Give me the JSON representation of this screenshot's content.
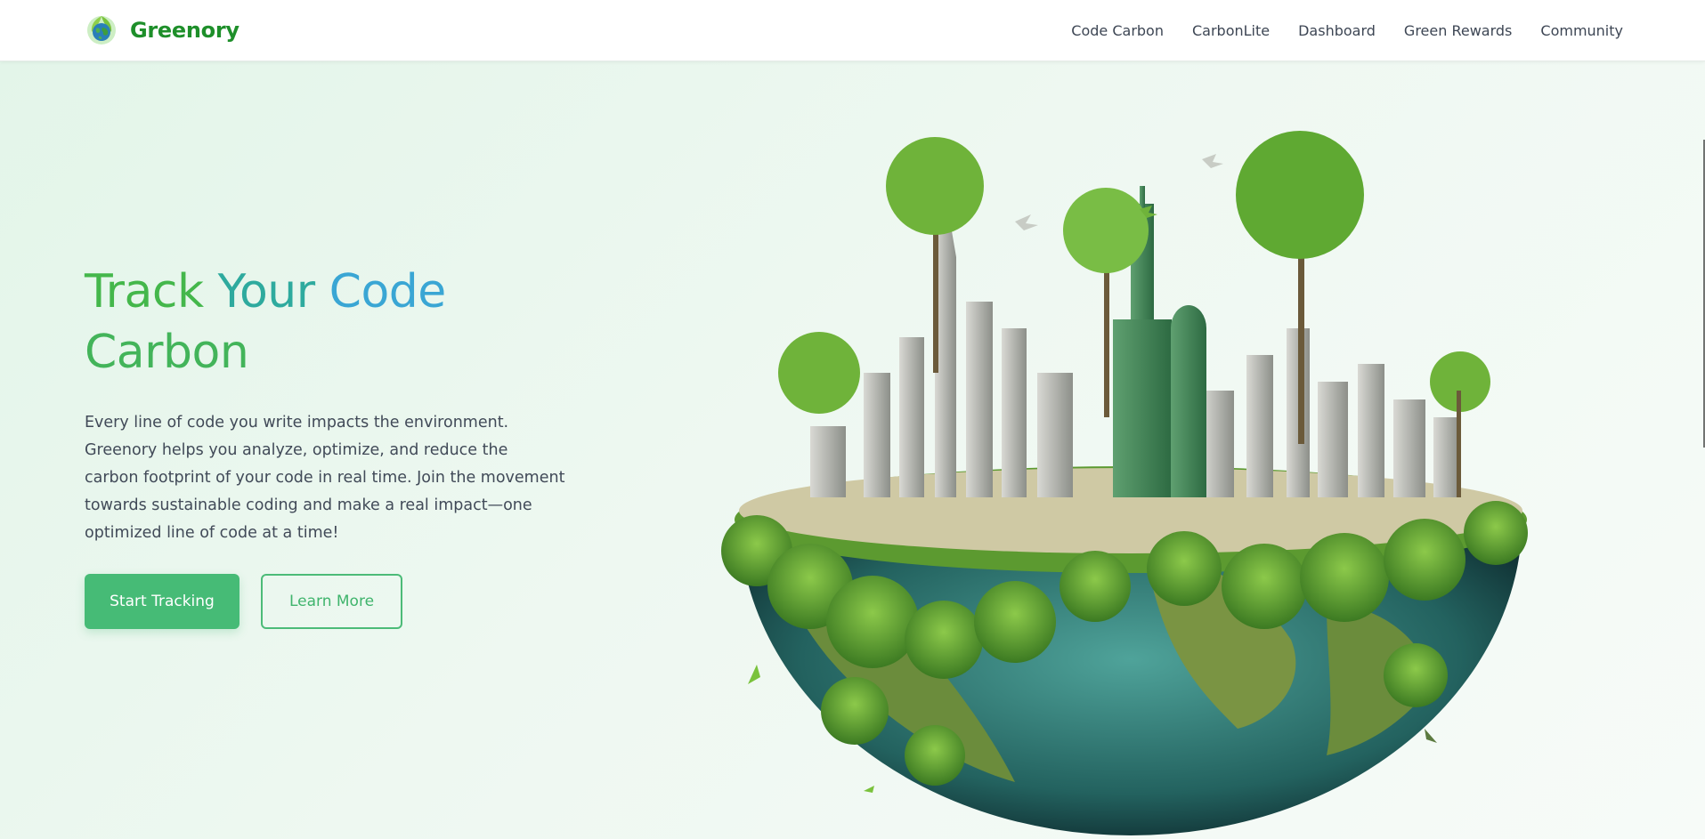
{
  "brand": {
    "name": "Greenory",
    "logo_icon": "earth-globe-leaf-icon"
  },
  "nav": {
    "items": [
      {
        "label": "Code Carbon"
      },
      {
        "label": "CarbonLite"
      },
      {
        "label": "Dashboard"
      },
      {
        "label": "Green Rewards"
      },
      {
        "label": "Community"
      }
    ]
  },
  "hero": {
    "title_words": [
      "Track",
      "Your",
      "Code",
      "Carbon"
    ],
    "description": "Every line of code you write impacts the environment. Greenory helps you analyze, optimize, and reduce the carbon footprint of your code in real time. Join the movement towards sustainable coding and make a real impact—one optimized line of code at a time!",
    "primary_button": "Start Tracking",
    "secondary_button": "Learn More",
    "illustration": "green-city-earth-illustration"
  },
  "colors": {
    "brand_green": "#1e8f2a",
    "accent_green": "#46bb76",
    "title_gradient": [
      "#44b74b",
      "#2eaa9e",
      "#3aa6d4"
    ],
    "hero_background": "#e3f5e9"
  }
}
